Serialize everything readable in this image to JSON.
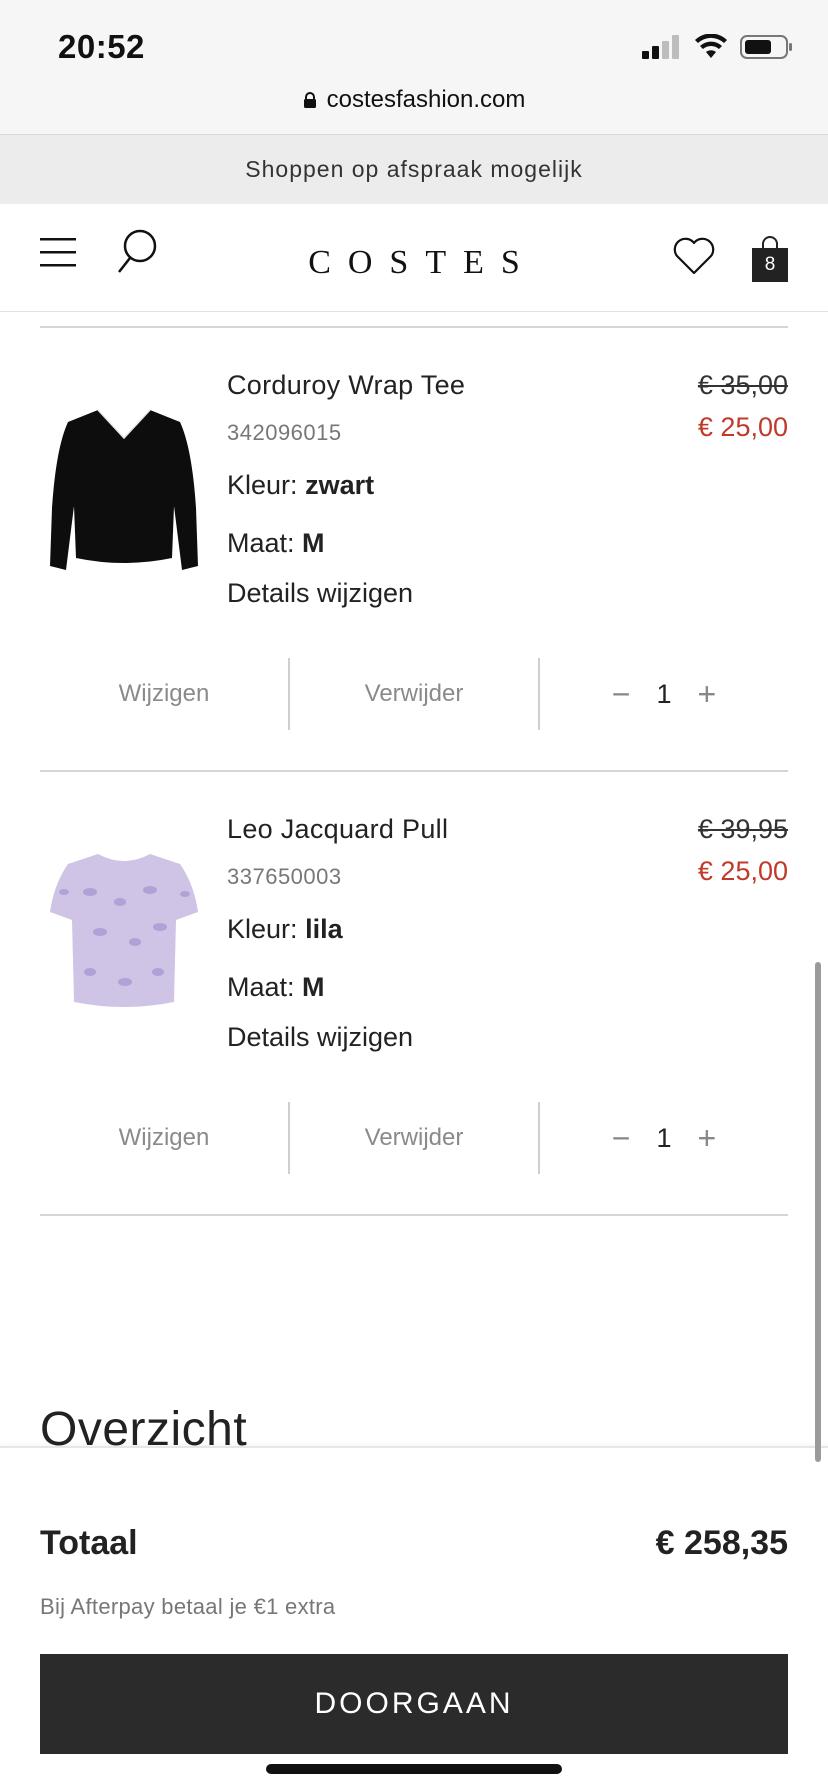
{
  "status_bar": {
    "time": "20:52"
  },
  "browser": {
    "url": "costesfashion.com"
  },
  "announcement": "Shoppen op afspraak mogelijk",
  "header": {
    "logo": "COSTES",
    "bag_count": "8"
  },
  "items": [
    {
      "name": "Corduroy Wrap Tee",
      "sku": "342096015",
      "color_label": "Kleur:",
      "color": "zwart",
      "size_label": "Maat:",
      "size": "M",
      "details_link": "Details wijzigen",
      "price_old": "€ 35,00",
      "price_new": "€ 25,00",
      "edit_label": "Wijzigen",
      "remove_label": "Verwijder",
      "quantity": "1",
      "thumbnail_color": "#0d0d0d"
    },
    {
      "name": "Leo Jacquard Pull",
      "sku": "337650003",
      "color_label": "Kleur:",
      "color": "lila",
      "size_label": "Maat:",
      "size": "M",
      "details_link": "Details wijzigen",
      "price_old": "€ 39,95",
      "price_new": "€ 25,00",
      "edit_label": "Wijzigen",
      "remove_label": "Verwijder",
      "quantity": "1",
      "thumbnail_color": "#cfc4e6"
    }
  ],
  "overview": {
    "title": "Overzicht"
  },
  "summary": {
    "total_label": "Totaal",
    "total_value": "€ 258,35",
    "afterpay_note": "Bij Afterpay betaal je €1 extra",
    "checkout_label": "DOORGAAN"
  },
  "colors": {
    "sale_red": "#c0392b",
    "cta_dark": "#2b2b2b"
  }
}
